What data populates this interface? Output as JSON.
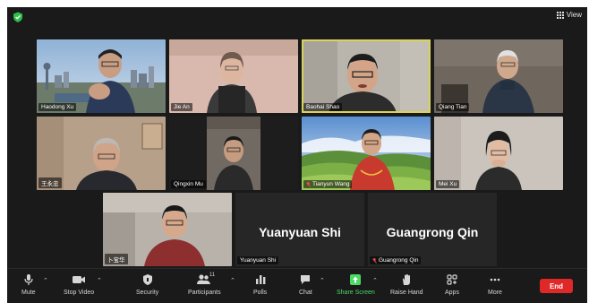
{
  "header": {
    "view_label": "View"
  },
  "colors": {
    "active_speaker": "#d9d35a",
    "share_green": "#4cd964",
    "end_red": "#e02828",
    "background": "#1a1a1a"
  },
  "participants": [
    {
      "name": "Haodong Xu",
      "muted": false
    },
    {
      "name": "Jie An",
      "muted": false
    },
    {
      "name": "Baohai Shao",
      "muted": false,
      "active_speaker": true
    },
    {
      "name": "Qiang Tian",
      "muted": false
    },
    {
      "name": "王永忠",
      "muted": false
    },
    {
      "name": "Qingxin Mu",
      "muted": false
    },
    {
      "name": "Tianyun Wang",
      "muted": true
    },
    {
      "name": "Mei Xu",
      "muted": false
    },
    {
      "name": "卜宝华",
      "muted": false
    },
    {
      "name": "Yuanyuan Shi",
      "display_name": "Yuanyuan Shi",
      "muted": false,
      "video_off": true
    },
    {
      "name": "Guangrong Qin",
      "display_name": "Guangrong Qin",
      "muted": true,
      "video_off": true
    }
  ],
  "toolbar": {
    "mute": "Mute",
    "stop_video": "Stop Video",
    "security": "Security",
    "participants": "Participants",
    "participant_count": "11",
    "polls": "Polls",
    "chat": "Chat",
    "share_screen": "Share Screen",
    "raise_hand": "Raise Hand",
    "apps": "Apps",
    "more": "More",
    "end": "End"
  }
}
